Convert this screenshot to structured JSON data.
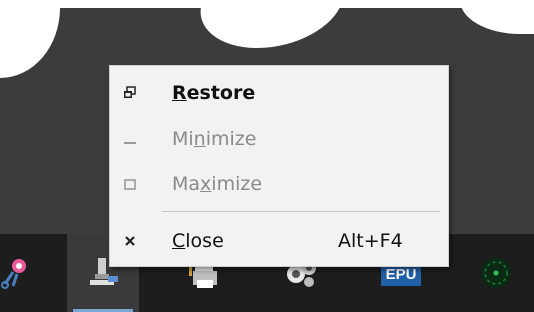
{
  "menu": {
    "items": [
      {
        "pre": "",
        "key": "R",
        "post": "estore",
        "shortcut": "",
        "enabled": true,
        "bold": true,
        "icon": "restore-icon"
      },
      {
        "pre": "Mi",
        "key": "n",
        "post": "imize",
        "shortcut": "",
        "enabled": false,
        "bold": false,
        "icon": "minimize-icon"
      },
      {
        "pre": "Ma",
        "key": "x",
        "post": "imize",
        "shortcut": "",
        "enabled": false,
        "bold": false,
        "icon": "maximize-icon"
      },
      {
        "pre": "",
        "key": "C",
        "post": "lose",
        "shortcut": "Alt+F4",
        "enabled": true,
        "bold": false,
        "icon": "close-icon"
      }
    ]
  },
  "taskbar": {
    "apps": [
      {
        "icon": "scissors-app-icon",
        "active": false
      },
      {
        "icon": "microscope-app-icon",
        "active": true
      },
      {
        "icon": "printer-app-icon",
        "active": false
      },
      {
        "icon": "gears-app-icon",
        "active": false
      },
      {
        "icon": "epu-app-icon",
        "label": "EPU",
        "active": false
      },
      {
        "icon": "radar-app-icon",
        "active": false
      }
    ]
  },
  "colors": {
    "menu_bg": "#f2f2f2",
    "disabled_text": "#8a8a8a",
    "taskbar_bg": "#1d1d1d",
    "active_indicator": "#7aa6d6"
  }
}
